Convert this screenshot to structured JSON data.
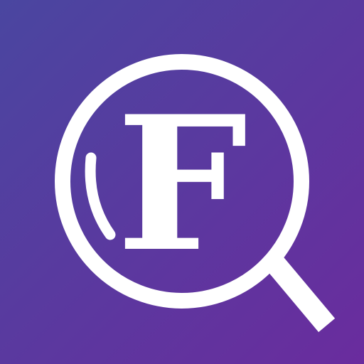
{
  "app_icon": {
    "icon": "magnifying-glass-icon",
    "letter": "F",
    "colors": {
      "gradient_start": "#4a46a0",
      "gradient_end": "#6a2c9e",
      "foreground": "#ffffff"
    }
  }
}
